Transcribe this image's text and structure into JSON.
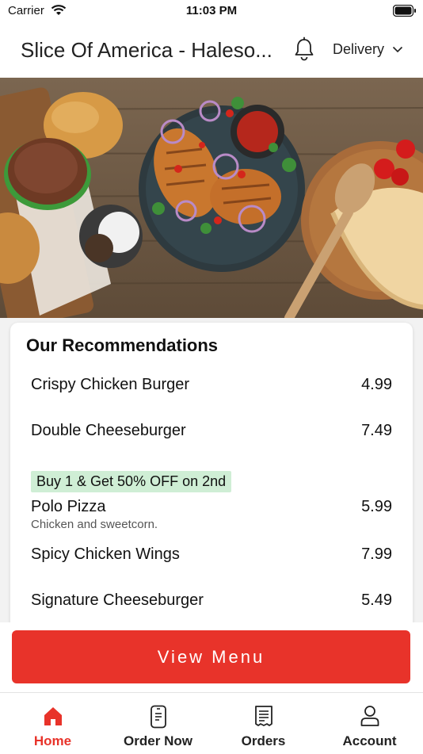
{
  "status_bar": {
    "carrier": "Carrier",
    "time": "11:03 PM"
  },
  "header": {
    "title": "Slice Of America - Haleso...",
    "delivery_label": "Delivery"
  },
  "recommendations": {
    "title": "Our Recommendations",
    "items": [
      {
        "name": "Crispy Chicken Burger",
        "price": "4.99",
        "description": "",
        "promo": ""
      },
      {
        "name": "Double Cheeseburger",
        "price": "7.49",
        "description": "",
        "promo": ""
      },
      {
        "name": "Polo Pizza",
        "price": "5.99",
        "description": "Chicken and sweetcorn.",
        "promo": "Buy 1 & Get 50% OFF on 2nd"
      },
      {
        "name": "Spicy Chicken Wings",
        "price": "7.99",
        "description": "",
        "promo": ""
      },
      {
        "name": "Signature Cheeseburger",
        "price": "5.49",
        "description": "",
        "promo": ""
      }
    ]
  },
  "cta": {
    "view_menu_label": "View Menu"
  },
  "tabs": [
    {
      "label": "Home",
      "icon": "home-icon",
      "active": true
    },
    {
      "label": "Order Now",
      "icon": "phone-order-icon",
      "active": false
    },
    {
      "label": "Orders",
      "icon": "receipt-icon",
      "active": false
    },
    {
      "label": "Account",
      "icon": "user-icon",
      "active": false
    }
  ],
  "colors": {
    "accent": "#e8332a",
    "promo_bg": "#cfeed5"
  }
}
